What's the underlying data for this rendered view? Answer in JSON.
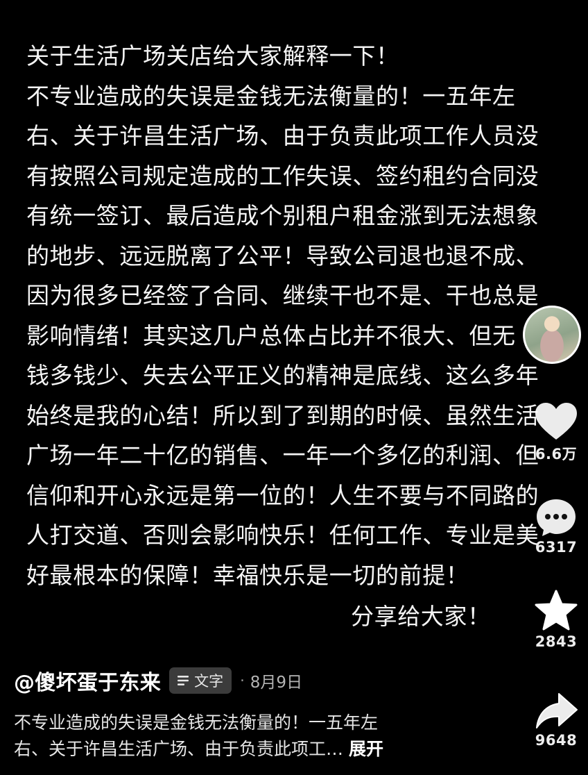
{
  "post": {
    "lines": [
      "关于生活广场关店给大家解释一下！",
      "不专业造成的失误是金钱无法衡量的！一五年左",
      "右、关于许昌生活广场、由于负责此项工作人员没",
      "有按照公司规定造成的工作失误、签约租约合同没",
      "有统一签订、最后造成个别租户租金涨到无法想象",
      "的地步、远远脱离了公平！导致公司退也退不成、",
      "因为很多已经签了合同、继续干也不是、干也总是",
      "影响情绪！其实这几户总体占比并不很大、但无",
      "钱多钱少、失去公平正义的精神是底线、这么多年",
      "始终是我的心结！所以到了到期的时候、虽然生活",
      "广场一年二十亿的销售、一年一个多亿的利润、但",
      "信仰和开心永远是第一位的！人生不要与不同路的",
      "人打交道、否则会影响快乐！任何工作、专业是美",
      "好最根本的保障！幸福快乐是一切的前提！"
    ],
    "sign_off": "分享给大家！"
  },
  "rail": {
    "avatar_icon": "avatar-girl-photo",
    "like_count": "6.6万",
    "comment_count": "6317",
    "favorite_count": "2843",
    "share_count": "9648"
  },
  "author": {
    "name": "@傻坏蛋于东来",
    "badge_label": "文字",
    "separator": "·",
    "date": "8月9日"
  },
  "caption": {
    "line1": "不专业造成的失误是金钱无法衡量的！一五年左",
    "line2": "右、关于许昌生活广场、由于负责此项工…",
    "expand_label": "展开"
  },
  "colors": {
    "background": "#000000",
    "text": "#f4f4f4",
    "badge_bg": "#3b3b3b",
    "icon_white": "#ffffff"
  }
}
